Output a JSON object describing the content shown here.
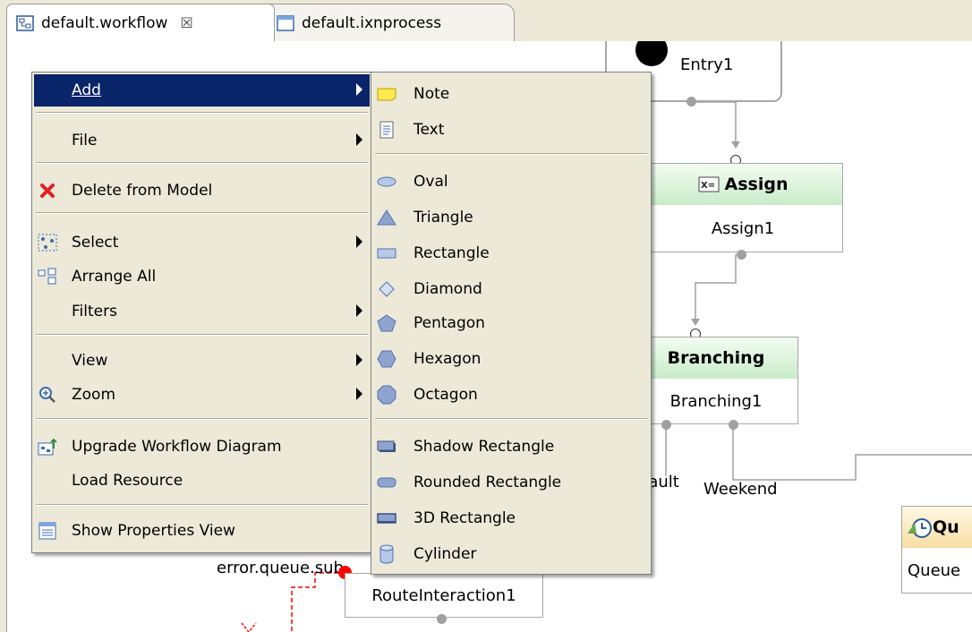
{
  "tabs": [
    {
      "label": "default.workflow",
      "close": "☒",
      "icon": "workflow-diagram-icon"
    },
    {
      "label": "default.ixnprocess",
      "icon": "process-file-icon"
    }
  ],
  "diagram": {
    "entry_label": "Entry1",
    "assign_title": "Assign",
    "assign_label": "Assign1",
    "branching_title": "Branching",
    "branching_label": "Branching1",
    "default_edge": "fault",
    "weekend_edge": "Weekend",
    "queue_title": "Qu",
    "queue_label": "Queue",
    "error_label": "error.queue.sub",
    "route_label": "RouteInteraction1"
  },
  "context_menu": {
    "items": [
      {
        "label": "Add",
        "submenu": true,
        "highlighted": true
      },
      {
        "label": "File",
        "submenu": true
      },
      {
        "label": "Delete from Model",
        "icon": "red-x-delete-icon"
      },
      {
        "label": "Select",
        "submenu": true,
        "icon": "select-nodes-icon"
      },
      {
        "label": "Arrange All",
        "icon": "arrange-all-icon"
      },
      {
        "label": "Filters",
        "submenu": true
      },
      {
        "label": "View",
        "submenu": true
      },
      {
        "label": "Zoom",
        "submenu": true,
        "icon": "zoom-magnifier-icon"
      },
      {
        "label": "Upgrade Workflow Diagram",
        "icon": "upgrade-diagram-icon"
      },
      {
        "label": "Load Resource"
      },
      {
        "label": "Show Properties View",
        "icon": "properties-view-icon"
      }
    ]
  },
  "add_submenu": {
    "items": [
      {
        "label": "Note",
        "icon": "note-icon"
      },
      {
        "label": "Text",
        "icon": "text-icon"
      },
      {
        "label": "Oval",
        "icon": "oval-icon"
      },
      {
        "label": "Triangle",
        "icon": "triangle-icon"
      },
      {
        "label": "Rectangle",
        "icon": "rectangle-icon"
      },
      {
        "label": "Diamond",
        "icon": "diamond-icon"
      },
      {
        "label": "Pentagon",
        "icon": "pentagon-icon"
      },
      {
        "label": "Hexagon",
        "icon": "hexagon-icon"
      },
      {
        "label": "Octagon",
        "icon": "octagon-icon"
      },
      {
        "label": "Shadow Rectangle",
        "icon": "shadow-rectangle-icon"
      },
      {
        "label": "Rounded Rectangle",
        "icon": "rounded-rectangle-icon"
      },
      {
        "label": "3D Rectangle",
        "icon": "3d-rectangle-icon"
      },
      {
        "label": "Cylinder",
        "icon": "cylinder-icon"
      }
    ]
  },
  "colors": {
    "menu_bg": "#ece9d8",
    "highlight": "#0a246a",
    "node_header": "#c9ecc9",
    "connector": "#a0a0a0",
    "error_link": "#ff0000"
  }
}
